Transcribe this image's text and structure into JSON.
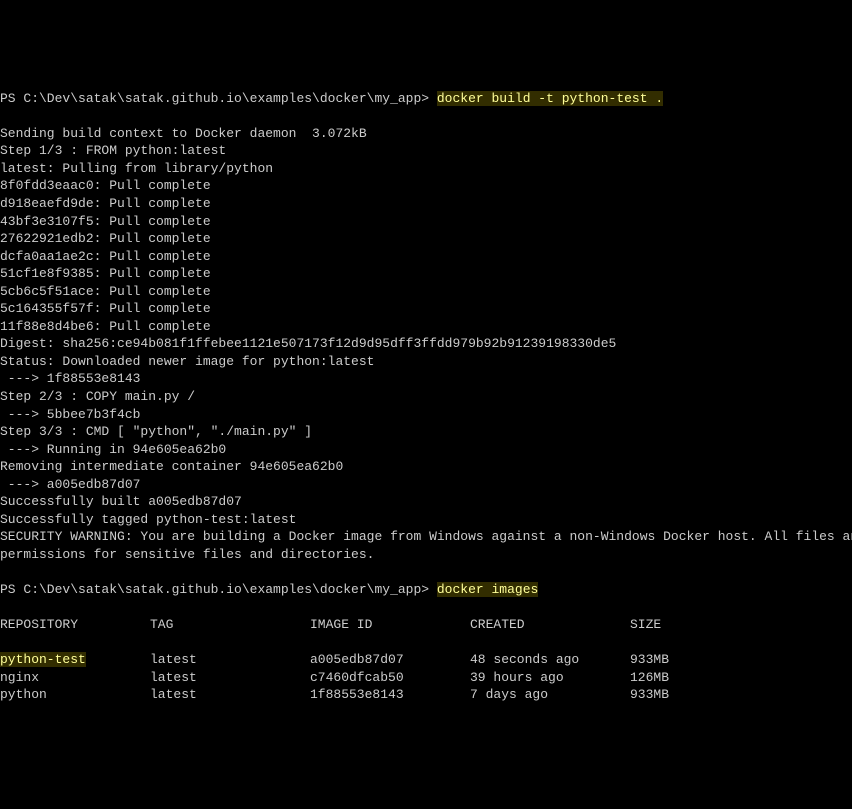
{
  "prompt1_prefix": "PS C:\\Dev\\satak\\satak.github.io\\examples\\docker\\my_app> ",
  "cmd1_docker": "docker",
  "cmd1_build": " build ",
  "cmd1_flag": "-t",
  "cmd1_rest": " python-test .",
  "output_lines": [
    "Sending build context to Docker daemon  3.072kB",
    "Step 1/3 : FROM python:latest",
    "latest: Pulling from library/python",
    "8f0fdd3eaac0: Pull complete",
    "d918eaefd9de: Pull complete",
    "43bf3e3107f5: Pull complete",
    "27622921edb2: Pull complete",
    "dcfa0aa1ae2c: Pull complete",
    "51cf1e8f9385: Pull complete",
    "5cb6c5f51ace: Pull complete",
    "5c164355f57f: Pull complete",
    "11f88e8d4be6: Pull complete",
    "Digest: sha256:ce94b081f1ffebee1121e507173f12d9d95dff3ffdd979b92b91239198330de5",
    "Status: Downloaded newer image for python:latest",
    " ---> 1f88553e8143",
    "Step 2/3 : COPY main.py /",
    " ---> 5bbee7b3f4cb",
    "Step 3/3 : CMD [ \"python\", \"./main.py\" ]",
    " ---> Running in 94e605ea62b0",
    "Removing intermediate container 94e605ea62b0",
    " ---> a005edb87d07",
    "Successfully built a005edb87d07",
    "Successfully tagged python-test:latest",
    "SECURITY WARNING: You are building a Docker image from Windows against a non-Windows Docker host. All files and directori",
    "permissions for sensitive files and directories."
  ],
  "prompt2_prefix": "PS C:\\Dev\\satak\\satak.github.io\\examples\\docker\\my_app> ",
  "cmd2_docker": "docker",
  "cmd2_images": " images",
  "table_header": {
    "repo": "REPOSITORY",
    "tag": "TAG",
    "imageid": "IMAGE ID",
    "created": "CREATED",
    "size": "SIZE"
  },
  "table_rows": [
    {
      "repo": "python-test",
      "tag": "latest",
      "imageid": "a005edb87d07",
      "created": "48 seconds ago",
      "size": "933MB",
      "highlight": true
    },
    {
      "repo": "nginx",
      "tag": "latest",
      "imageid": "c7460dfcab50",
      "created": "39 hours ago",
      "size": "126MB",
      "highlight": false
    },
    {
      "repo": "python",
      "tag": "latest",
      "imageid": "1f88553e8143",
      "created": "7 days ago",
      "size": "933MB",
      "highlight": false
    }
  ]
}
